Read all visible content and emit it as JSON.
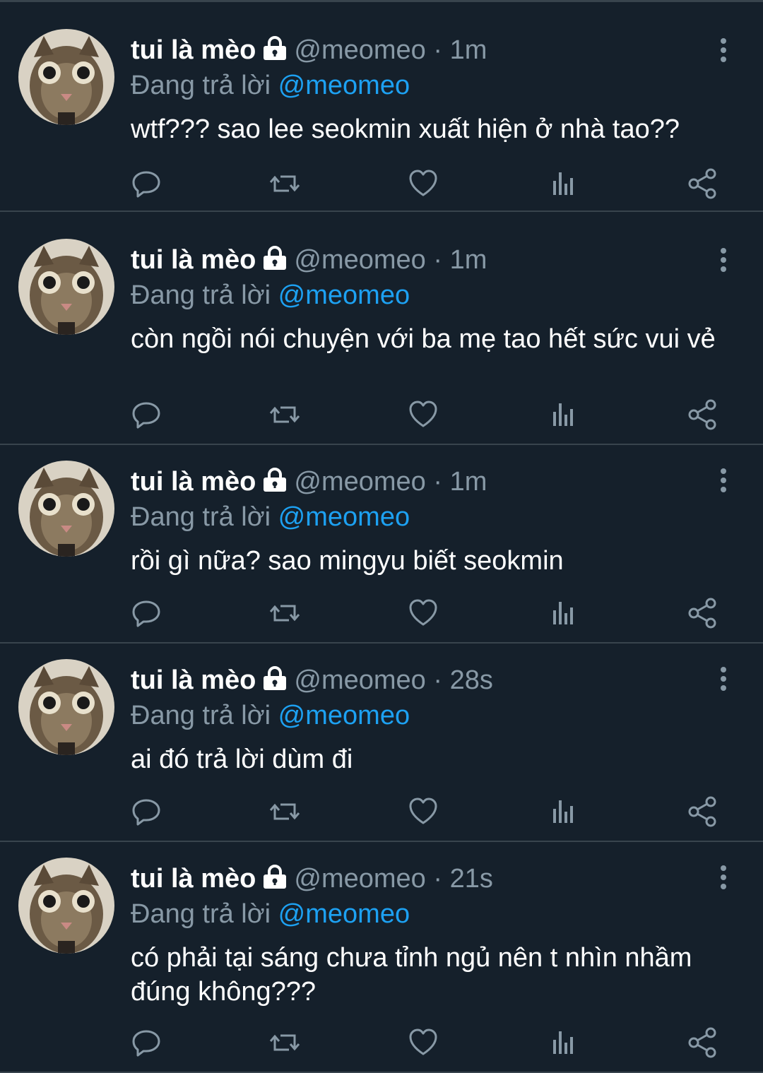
{
  "tweets": [
    {
      "display_name": "tui là mèo",
      "handle": "@meomeo",
      "separator": "·",
      "time": "1m",
      "replying_label": "Đang trả lời",
      "replying_to": "@meomeo",
      "text": "wtf??? sao lee seokmin xuất hiện ở nhà tao??"
    },
    {
      "display_name": "tui là mèo",
      "handle": "@meomeo",
      "separator": "·",
      "time": "1m",
      "replying_label": "Đang trả lời",
      "replying_to": "@meomeo",
      "text": "còn ngồi nói chuyện với ba mẹ tao hết sức vui vẻ"
    },
    {
      "display_name": "tui là mèo",
      "handle": "@meomeo",
      "separator": "·",
      "time": "1m",
      "replying_label": "Đang trả lời",
      "replying_to": "@meomeo",
      "text": "rồi gì nữa? sao mingyu biết seokmin"
    },
    {
      "display_name": "tui là mèo",
      "handle": "@meomeo",
      "separator": "·",
      "time": "28s",
      "replying_label": "Đang trả lời",
      "replying_to": "@meomeo",
      "text": "ai đó trả lời dùm đi"
    },
    {
      "display_name": "tui là mèo",
      "handle": "@meomeo",
      "separator": "·",
      "time": "21s",
      "replying_label": "Đang trả lời",
      "replying_to": "@meomeo",
      "text": "có phải tại sáng chưa tỉnh ngủ nên t nhìn nhầm đúng không???"
    }
  ],
  "theme": {
    "background": "#15202b",
    "divider": "#38444d",
    "text_primary": "#ffffff",
    "text_secondary": "#8899a6",
    "accent": "#1da1f2"
  },
  "icons": {
    "lock": "lock-icon",
    "more": "more-vertical-icon",
    "reply": "reply-icon",
    "retweet": "retweet-icon",
    "like": "heart-icon",
    "analytics": "analytics-icon",
    "share": "share-icon"
  }
}
